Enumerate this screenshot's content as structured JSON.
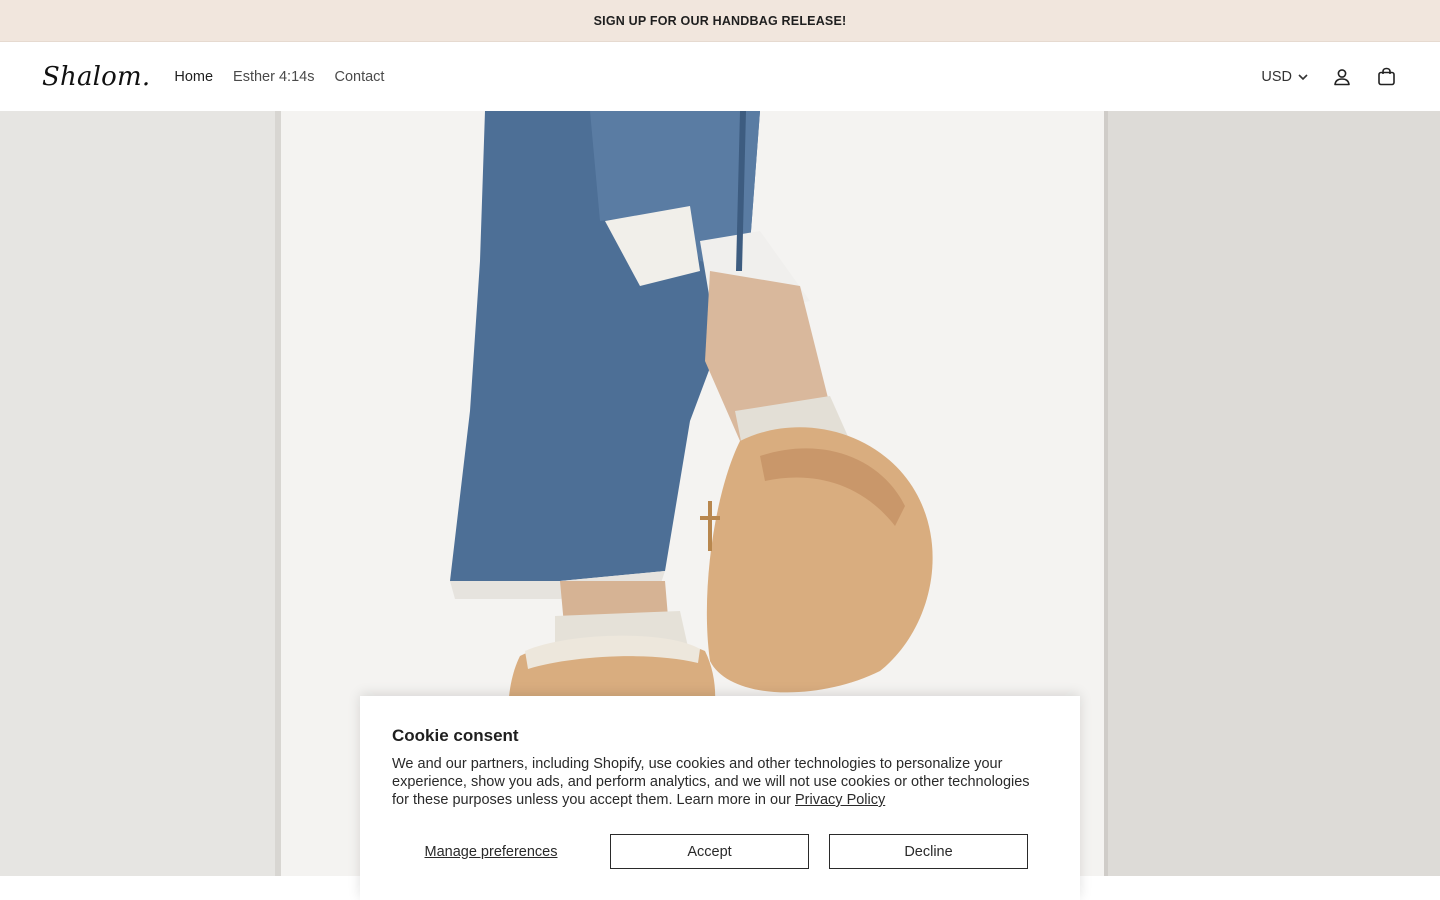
{
  "announcement": {
    "text": "SIGN UP FOR OUR HANDBAG RELEASE!"
  },
  "header": {
    "logo": "Shalom.",
    "nav": [
      {
        "label": "Home"
      },
      {
        "label": "Esther 4:14s"
      },
      {
        "label": "Contact"
      }
    ],
    "currency": "USD",
    "icons": [
      "chevron-down-icon",
      "account-icon",
      "cart-bag-icon"
    ]
  },
  "hero": {
    "image": "model-wearing-distressed-jeans-and-tan-suede-slippers"
  },
  "cookie": {
    "title": "Cookie consent",
    "body": "We and our partners, including Shopify, use cookies and other technologies to personalize your experience, show you ads, and perform analytics, and we will not use cookies or other technologies for these purposes unless you accept them. Learn more in our ",
    "privacy_link": "Privacy Policy",
    "manage_label": "Manage preferences",
    "accept_label": "Accept",
    "decline_label": "Decline"
  },
  "colors": {
    "announcement_bg": "#f1e6dd",
    "text": "#1f1f1f",
    "denim": "#4d6f96",
    "suede": "#d9ad7f"
  }
}
